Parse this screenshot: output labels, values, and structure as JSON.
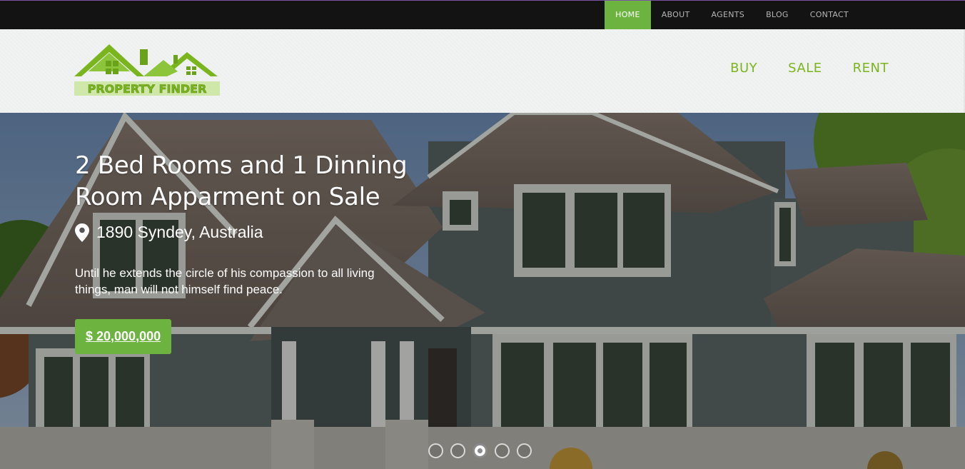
{
  "top_nav": [
    "HOME",
    "ABOUT",
    "AGENTS",
    "BLOG",
    "CONTACT"
  ],
  "logo_text": "PROPERTY FINDER",
  "main_nav": [
    "BUY",
    "SALE",
    "RENT"
  ],
  "hero": {
    "title_line1": "2 Bed Rooms and 1 Dinning",
    "title_line2": "Room Apparment on Sale",
    "location": "1890 Syndey, Australia",
    "description": "Until he extends the circle of his compassion to all living things, man will not himself find peace.",
    "price": "$ 20,000,000"
  },
  "slider": {
    "total_slides": 5,
    "active_slide": 3
  },
  "colors": {
    "accent": "#6cb33f",
    "nav_text": "#7ab51d",
    "topbar": "#131313"
  }
}
